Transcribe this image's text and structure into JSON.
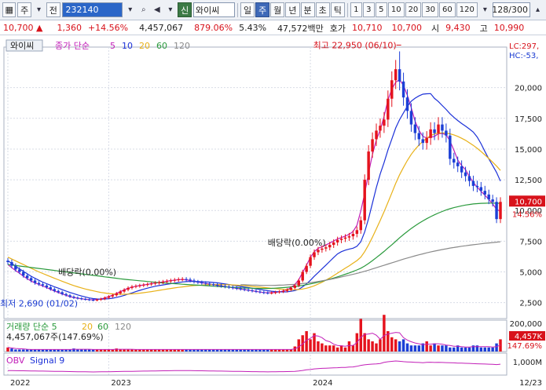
{
  "toolbar": {
    "market_label": "주",
    "prev_label": "전",
    "code_value": "232140",
    "badge_label": "신",
    "name_value": "와이씨",
    "period_tabs": [
      "일",
      "주",
      "월",
      "년",
      "분",
      "초",
      "틱"
    ],
    "active_period": "주",
    "numbers": [
      "1",
      "3",
      "5",
      "10",
      "20",
      "30",
      "60",
      "120"
    ],
    "count_value": "128",
    "count_total": "/300"
  },
  "quote": {
    "price": "10,700",
    "direction": "▲",
    "change": "1,360",
    "change_pct": "+14.56%",
    "volume": "4,457,067",
    "volume_ratio": "879.06%",
    "turnover": "5.43%",
    "amount": "47,572백만",
    "ask_label": "호가",
    "ask1": "10,710",
    "bid1": "10,700",
    "open_label": "시",
    "open": "9,430",
    "high_label": "고",
    "high": "10,990"
  },
  "legend": {
    "stock_name": "와이씨",
    "ma_label": "종가 단순",
    "ma_periods": [
      "5",
      "10",
      "20",
      "60",
      "120"
    ],
    "ma_colors": [
      "#c21fb8",
      "#1c31d8",
      "#e8b118",
      "#2a9a3c",
      "#8a8a8a"
    ],
    "volume_label": "거래량 단순",
    "volume_value": "4,457,067주(147.69%)",
    "obv_label": "OBV",
    "obv_signal": "Signal 9"
  },
  "annotations": {
    "high_label": "최고 22,950 (06/10)",
    "low_label": "최저 2,690 (01/02)",
    "dividend_1": "배당락(0.00%)",
    "dividend_2": "배당락(0.00%)",
    "lc": "LC:297,",
    "hc": "HC:-53,"
  },
  "price_tag": {
    "price": "10,700",
    "pct": "14.56%"
  },
  "volume_tag": {
    "value": "4,457K",
    "pct": "147.69%"
  },
  "date_label": "12/23",
  "chart_data": {
    "type": "candlestick",
    "y_ticks": [
      "20,000",
      "17,500",
      "15,000",
      "12,500",
      "10,000",
      "7,500",
      "5,000",
      "2,500"
    ],
    "y_values": [
      20000,
      17500,
      15000,
      12500,
      10000,
      7500,
      5000,
      2500
    ],
    "ylim": [
      1200,
      23300
    ],
    "volume_ticks": [
      "200,000"
    ],
    "obv_ticks": [
      "1,000M"
    ],
    "x_labels": [
      "2022",
      "2023",
      "2024"
    ],
    "x_label_index": [
      0,
      26,
      78
    ],
    "colors": {
      "up": "#e5131d",
      "down": "#1c3fd6",
      "ma5": "#c21fb8",
      "ma10": "#1c31d8",
      "ma20": "#e8b118",
      "ma60": "#2a9a3c",
      "ma120": "#8a8a8a"
    },
    "closes": [
      5800,
      5500,
      5200,
      5000,
      4700,
      4500,
      4300,
      4100,
      4000,
      3900,
      3750,
      3600,
      3450,
      3350,
      3200,
      3100,
      2980,
      2900,
      2850,
      2800,
      2760,
      2720,
      2700,
      2740,
      2800,
      2900,
      3000,
      3100,
      3250,
      3400,
      3550,
      3700,
      3800,
      3850,
      3900,
      3950,
      4000,
      4050,
      4100,
      4150,
      4200,
      4250,
      4300,
      4350,
      4400,
      4420,
      4380,
      4300,
      4200,
      4150,
      4100,
      4050,
      4000,
      3950,
      3900,
      3850,
      3800,
      3750,
      3700,
      3650,
      3600,
      3550,
      3500,
      3450,
      3400,
      3350,
      3300,
      3280,
      3300,
      3350,
      3400,
      3450,
      3550,
      3700,
      3900,
      4300,
      5000,
      5500,
      6200,
      6600,
      6800,
      6900,
      7000,
      7200,
      7400,
      7600,
      7700,
      7800,
      7900,
      8100,
      8400,
      9200,
      12500,
      14800,
      15800,
      16500,
      16900,
      17400,
      19100,
      20600,
      21500,
      20500,
      19200,
      18100,
      17000,
      16300,
      15800,
      15500,
      15900,
      16600,
      16300,
      17000,
      16500,
      16100,
      14200,
      13900,
      13600,
      13100,
      12800,
      12400,
      12000,
      11900,
      11600,
      11300,
      10900,
      10700,
      9300,
      10700
    ],
    "highs_extra": {
      "101": 22950
    },
    "ma_series": [
      {
        "name": "5",
        "color": "#c21fb8",
        "values": [
          5600,
          5350,
          5100,
          4900,
          4650,
          4450,
          4250,
          4100,
          3980,
          3850,
          3720,
          3580,
          3450,
          3330,
          3210,
          3100,
          2990,
          2920,
          2860,
          2810,
          2770,
          2740,
          2730,
          2750,
          2800,
          2880,
          2990,
          3110,
          3250,
          3400,
          3540,
          3660,
          3760,
          3830,
          3890,
          3940,
          3990,
          4040,
          4090,
          4140,
          4190,
          4240,
          4290,
          4330,
          4370,
          4380,
          4360,
          4300,
          4230,
          4170,
          4110,
          4060,
          4010,
          3960,
          3910,
          3860,
          3810,
          3760,
          3710,
          3660,
          3610,
          3560,
          3510,
          3460,
          3410,
          3360,
          3320,
          3300,
          3310,
          3340,
          3380,
          3450,
          3560,
          3730,
          3970,
          4370,
          4960,
          5540,
          6180,
          6640,
          6920,
          7060,
          7190,
          7350,
          7520,
          7680,
          7800,
          7920,
          8060,
          8290,
          8790,
          9970,
          11380,
          13020,
          14560,
          15740,
          16560,
          17660,
          18980,
          19880,
          20440,
          20640,
          20180,
          19380,
          18380,
          17260,
          16520,
          16030,
          15900,
          15960,
          16030,
          16250,
          16270,
          16160,
          15660,
          14900,
          14100,
          13660,
          13320,
          12760,
          12280,
          11900,
          11560,
          11240,
          10900,
          10530,
          10100,
          9920
        ]
      },
      {
        "name": "10",
        "color": "#1c31d8",
        "values": [
          5900,
          5700,
          5450,
          5250,
          5050,
          4850,
          4650,
          4480,
          4320,
          4170,
          4040,
          3920,
          3790,
          3680,
          3560,
          3440,
          3330,
          3230,
          3130,
          3040,
          2960,
          2880,
          2830,
          2800,
          2790,
          2800,
          2820,
          2860,
          2920,
          3000,
          3090,
          3190,
          3290,
          3400,
          3500,
          3590,
          3680,
          3760,
          3830,
          3890,
          3940,
          3990,
          4040,
          4090,
          4140,
          4180,
          4210,
          4220,
          4220,
          4210,
          4200,
          4190,
          4170,
          4140,
          4110,
          4070,
          4020,
          3970,
          3920,
          3870,
          3820,
          3770,
          3720,
          3670,
          3620,
          3570,
          3520,
          3470,
          3430,
          3400,
          3380,
          3370,
          3380,
          3420,
          3480,
          3590,
          3790,
          4020,
          4320,
          4640,
          4950,
          5250,
          5550,
          5860,
          6170,
          6460,
          6650,
          6770,
          6860,
          6930,
          7080,
          7450,
          8250,
          9330,
          10600,
          11860,
          12980,
          13900,
          14920,
          15820,
          16720,
          17390,
          17950,
          18480,
          18890,
          19140,
          19330,
          19470,
          19500,
          19510,
          19120,
          18870,
          18540,
          18220,
          17880,
          17580,
          17320,
          17080,
          16860,
          16630,
          16380,
          15980,
          15440,
          14790,
          14200,
          13660,
          13090,
          12390
        ]
      },
      {
        "name": "20",
        "color": "#e8b118",
        "values": [
          6200,
          6050,
          5900,
          5750,
          5600,
          5450,
          5300,
          5150,
          5000,
          4870,
          4740,
          4610,
          4480,
          4360,
          4240,
          4120,
          4000,
          3890,
          3790,
          3700,
          3610,
          3530,
          3460,
          3390,
          3330,
          3280,
          3240,
          3210,
          3190,
          3180,
          3180,
          3190,
          3210,
          3240,
          3270,
          3310,
          3350,
          3400,
          3450,
          3500,
          3550,
          3600,
          3650,
          3700,
          3740,
          3780,
          3820,
          3860,
          3890,
          3910,
          3930,
          3950,
          3960,
          3970,
          3970,
          3970,
          3960,
          3950,
          3940,
          3920,
          3900,
          3880,
          3850,
          3820,
          3790,
          3760,
          3730,
          3700,
          3670,
          3640,
          3610,
          3580,
          3560,
          3550,
          3550,
          3570,
          3610,
          3670,
          3760,
          3870,
          4010,
          4160,
          4330,
          4510,
          4700,
          4900,
          5100,
          5300,
          5500,
          5710,
          5920,
          6200,
          6650,
          7200,
          7830,
          8500,
          9190,
          9900,
          10650,
          11430,
          12210,
          12900,
          13510,
          14070,
          14560,
          14980,
          15330,
          15630,
          15880,
          16100,
          16230,
          16300,
          16320,
          16300,
          16240,
          16150,
          16030,
          15880,
          15710,
          15510,
          15300,
          15060,
          14800,
          14520,
          14230,
          13930,
          13610,
          13260
        ]
      },
      {
        "name": "60",
        "color": "#2a9a3c",
        "values": [
          5600,
          5560,
          5520,
          5480,
          5440,
          5400,
          5360,
          5320,
          5280,
          5240,
          5200,
          5160,
          5120,
          5080,
          5040,
          5000,
          4960,
          4920,
          4880,
          4840,
          4800,
          4760,
          4720,
          4680,
          4640,
          4600,
          4560,
          4520,
          4480,
          4440,
          4400,
          4370,
          4340,
          4310,
          4280,
          4250,
          4220,
          4190,
          4160,
          4130,
          4100,
          4080,
          4060,
          4040,
          4020,
          4000,
          3980,
          3960,
          3940,
          3920,
          3900,
          3880,
          3860,
          3840,
          3820,
          3800,
          3780,
          3760,
          3740,
          3720,
          3700,
          3690,
          3680,
          3670,
          3660,
          3650,
          3650,
          3650,
          3660,
          3680,
          3700,
          3720,
          3750,
          3780,
          3810,
          3850,
          3900,
          3960,
          4020,
          4090,
          4160,
          4240,
          4320,
          4410,
          4500,
          4600,
          4700,
          4810,
          4920,
          5040,
          5160,
          5300,
          5480,
          5690,
          5920,
          6160,
          6410,
          6670,
          6940,
          7210,
          7490,
          7770,
          8040,
          8290,
          8530,
          8750,
          8960,
          9150,
          9330,
          9500,
          9650,
          9790,
          9920,
          10040,
          10140,
          10230,
          10310,
          10380,
          10440,
          10490,
          10530,
          10560,
          10580,
          10590,
          10600,
          10600,
          10590,
          10580
        ]
      },
      {
        "name": "120",
        "color": "#8a8a8a",
        "values": [
          null,
          null,
          null,
          null,
          null,
          null,
          null,
          null,
          null,
          null,
          null,
          null,
          null,
          null,
          null,
          null,
          null,
          null,
          null,
          null,
          null,
          null,
          null,
          null,
          null,
          null,
          null,
          null,
          null,
          null,
          null,
          null,
          null,
          null,
          null,
          null,
          null,
          null,
          null,
          null,
          null,
          null,
          null,
          null,
          null,
          null,
          null,
          null,
          null,
          null,
          null,
          null,
          null,
          null,
          null,
          null,
          null,
          null,
          null,
          null,
          3960,
          3950,
          3940,
          3930,
          3920,
          3910,
          3900,
          3900,
          3900,
          3910,
          3920,
          3930,
          3950,
          3970,
          3990,
          4020,
          4050,
          4090,
          4130,
          4170,
          4220,
          4270,
          4330,
          4390,
          4450,
          4520,
          4590,
          4660,
          4730,
          4800,
          4880,
          4960,
          5050,
          5140,
          5240,
          5340,
          5440,
          5540,
          5640,
          5740,
          5840,
          5940,
          6040,
          6130,
          6220,
          6310,
          6390,
          6470,
          6550,
          6620,
          6690,
          6760,
          6820,
          6880,
          6940,
          6990,
          7040,
          7090,
          7130,
          7170,
          7210,
          7250,
          7290,
          7330,
          7360,
          7390,
          7420,
          7450
        ]
      }
    ],
    "volume_relative": [
      0.2,
      0.15,
      0.1,
      0.1,
      0.1,
      0.1,
      0.1,
      0.1,
      0.1,
      0.1,
      0.1,
      0.1,
      0.1,
      0.1,
      0.1,
      0.1,
      0.1,
      0.15,
      0.1,
      0.1,
      0.1,
      0.1,
      0.1,
      0.1,
      0.1,
      0.1,
      0.1,
      0.1,
      0.15,
      0.1,
      0.1,
      0.1,
      0.1,
      0.1,
      0.1,
      0.1,
      0.1,
      0.1,
      0.1,
      0.1,
      0.1,
      0.1,
      0.1,
      0.1,
      0.1,
      0.1,
      0.1,
      0.1,
      0.1,
      0.1,
      0.1,
      0.1,
      0.1,
      0.1,
      0.1,
      0.1,
      0.1,
      0.1,
      0.1,
      0.1,
      0.1,
      0.1,
      0.1,
      0.1,
      0.1,
      0.1,
      0.1,
      0.1,
      0.1,
      0.1,
      0.1,
      0.1,
      0.1,
      0.1,
      0.25,
      0.6,
      0.8,
      1.0,
      0.6,
      0.9,
      0.5,
      0.4,
      0.3,
      0.3,
      0.3,
      0.2,
      0.3,
      0.2,
      0.5,
      0.3,
      0.9,
      1.6,
      0.9,
      0.6,
      0.5,
      0.4,
      0.6,
      1.8,
      1.0,
      0.7,
      0.6,
      0.5,
      0.6,
      0.4,
      0.3,
      0.3,
      0.3,
      0.4,
      0.5,
      0.3,
      0.4,
      0.3,
      0.3,
      0.3,
      0.2,
      0.2,
      0.3,
      0.2,
      0.2,
      0.2,
      0.3,
      0.3,
      0.2,
      0.2,
      0.2,
      0.2,
      0.4,
      0.6
    ]
  }
}
